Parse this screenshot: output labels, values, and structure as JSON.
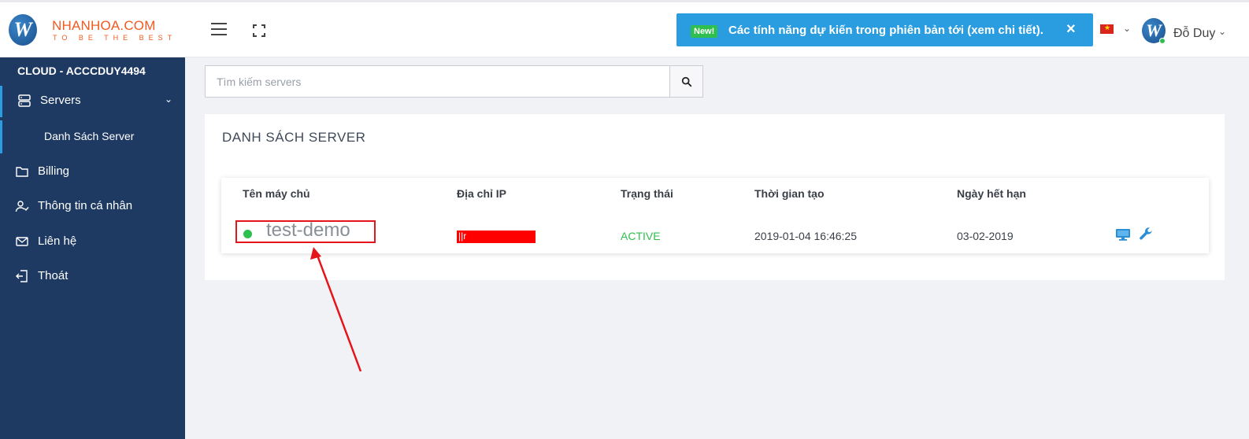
{
  "header": {
    "logo_letter": "W",
    "logo_title": "NHANHOA.COM",
    "logo_subtitle": "TO BE THE BEST",
    "notice_badge": "New!",
    "notice_text": "Các tính năng dự kiến trong phiên bản tới (xem chi tiết).",
    "notice_close": "×",
    "user_initial": "W",
    "user_name": "Đỗ Duy",
    "language_flag": "vietnam-flag-icon"
  },
  "sidebar": {
    "account": "CLOUD - ACCCDUY4494",
    "items": [
      {
        "label": "Servers",
        "icon": "server-icon"
      },
      {
        "label": "Danh Sách Server"
      },
      {
        "label": "Billing",
        "icon": "folder-icon"
      },
      {
        "label": "Thông tin cá nhân",
        "icon": "user-check-icon"
      },
      {
        "label": "Liên hệ",
        "icon": "mail-icon"
      },
      {
        "label": "Thoát",
        "icon": "logout-icon"
      }
    ]
  },
  "search": {
    "placeholder": "Tìm kiếm servers"
  },
  "card": {
    "title": "DANH SÁCH SERVER"
  },
  "table": {
    "headers": [
      "Tên máy chủ",
      "Địa chỉ IP",
      "Trạng thái",
      "Thời gian tạo",
      "Ngày hết hạn"
    ],
    "rows": [
      {
        "name": "test-demo",
        "ip": "||r",
        "status": "ACTIVE",
        "created": "2019-01-04 16:46:25",
        "expires": "03-02-2019"
      }
    ]
  },
  "colors": {
    "sidebar_bg": "#1e3a62",
    "accent_blue": "#2a9de0",
    "active_green": "#2fbf4f",
    "annotation_red": "#e5141b",
    "brand_orange": "#f05a22"
  }
}
